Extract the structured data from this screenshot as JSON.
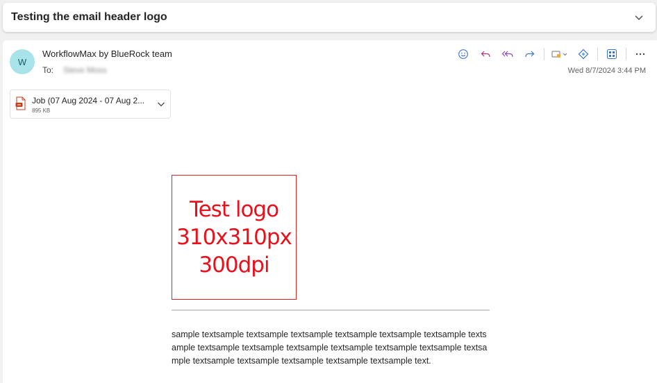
{
  "subject": {
    "title": "Testing the email header logo"
  },
  "message": {
    "avatar_initial": "W",
    "avatar_color": "#a8e3ea",
    "sender": "WorkflowMax by BlueRock team",
    "to_label": "To:",
    "to_name": "Steve Moss",
    "date": "Wed 8/7/2024 3:44 PM",
    "toolbar": [
      {
        "icon": "emoji-icon"
      },
      {
        "icon": "reply-icon"
      },
      {
        "icon": "reply-all-icon"
      },
      {
        "icon": "forward-icon"
      },
      {
        "icon": "teams-share-icon"
      },
      {
        "icon": "copilot-icon"
      },
      {
        "icon": "apps-icon"
      },
      {
        "icon": "more-icon"
      }
    ]
  },
  "attachment": {
    "name": "Job (07 Aug 2024 - 07 Aug 2...",
    "size": "895 KB",
    "icon": "pdf-icon"
  },
  "body": {
    "logo_lines": [
      "Test logo",
      "310x310px",
      "300dpi"
    ],
    "logo_color": "#e8101b",
    "text": "sample textsample textsample textsample textsample textsample textsample textsample textsample textsample textsample textsample textsample textsample textsample textsample textsample textsample textsample textsample text."
  }
}
